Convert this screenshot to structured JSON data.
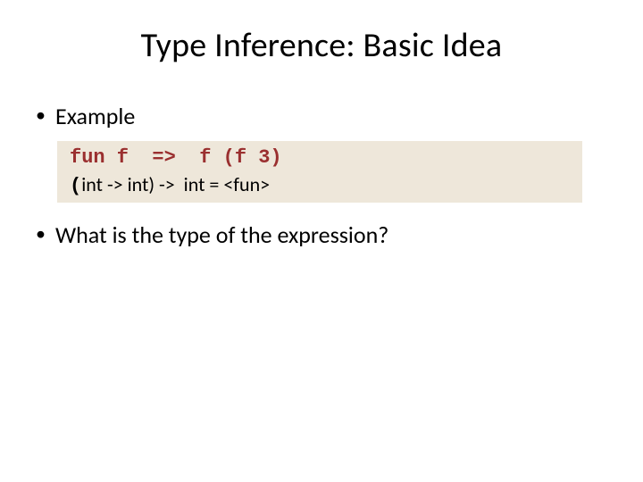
{
  "title": "Type Inference: Basic Idea",
  "bullets": {
    "example": "Example",
    "question": "What is the type of the expression?"
  },
  "code": {
    "line1": "fun f  =>  f (f 3)",
    "line2_open": "(",
    "line2_rest": "int -> int) ->  int = <fun>"
  }
}
